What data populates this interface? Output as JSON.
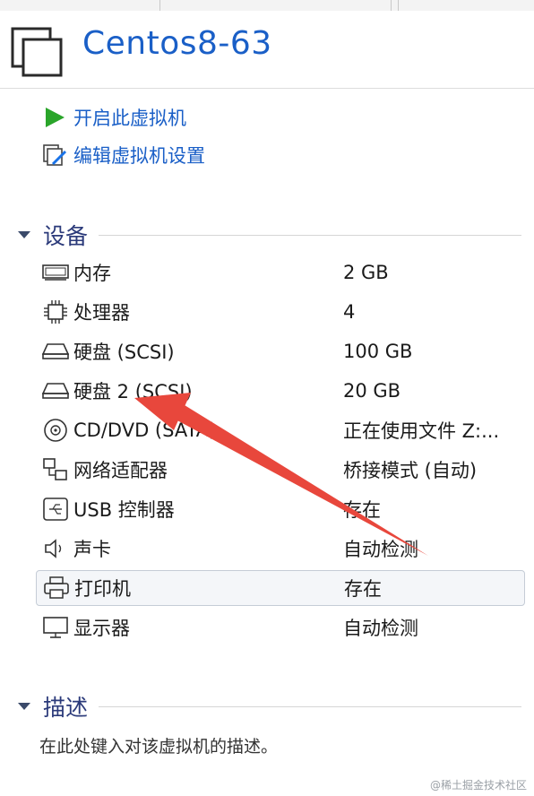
{
  "vm": {
    "title": "Centos8-63"
  },
  "actions": [
    {
      "label": "开启此虚拟机",
      "icon": "play-icon"
    },
    {
      "label": "编辑虚拟机设置",
      "icon": "edit-settings-icon"
    }
  ],
  "devices_section": {
    "title": "设备"
  },
  "devices": [
    {
      "name": "内存",
      "value": "2 GB",
      "icon": "memory-icon"
    },
    {
      "name": "处理器",
      "value": "4",
      "icon": "processor-icon"
    },
    {
      "name": "硬盘 (SCSI)",
      "value": "100 GB",
      "icon": "hard-disk-icon"
    },
    {
      "name": "硬盘 2 (SCSI)",
      "value": "20 GB",
      "icon": "hard-disk-icon"
    },
    {
      "name": "CD/DVD (SATA)",
      "value": "正在使用文件 Z:...",
      "icon": "cd-dvd-icon"
    },
    {
      "name": "网络适配器",
      "value": "桥接模式 (自动)",
      "icon": "network-adapter-icon"
    },
    {
      "name": "USB 控制器",
      "value": "存在",
      "icon": "usb-icon"
    },
    {
      "name": "声卡",
      "value": "自动检测",
      "icon": "speaker-icon"
    },
    {
      "name": "打印机",
      "value": "存在",
      "icon": "printer-icon"
    },
    {
      "name": "显示器",
      "value": "自动检测",
      "icon": "monitor-icon"
    }
  ],
  "description_section": {
    "title": "描述",
    "placeholder": "在此处键入对该虚拟机的描述。"
  },
  "watermark": "@稀土掘金技术社区",
  "colors": {
    "accent": "#1a5fc7",
    "arrow": "#e8473c",
    "section": "#2b3a7a"
  }
}
